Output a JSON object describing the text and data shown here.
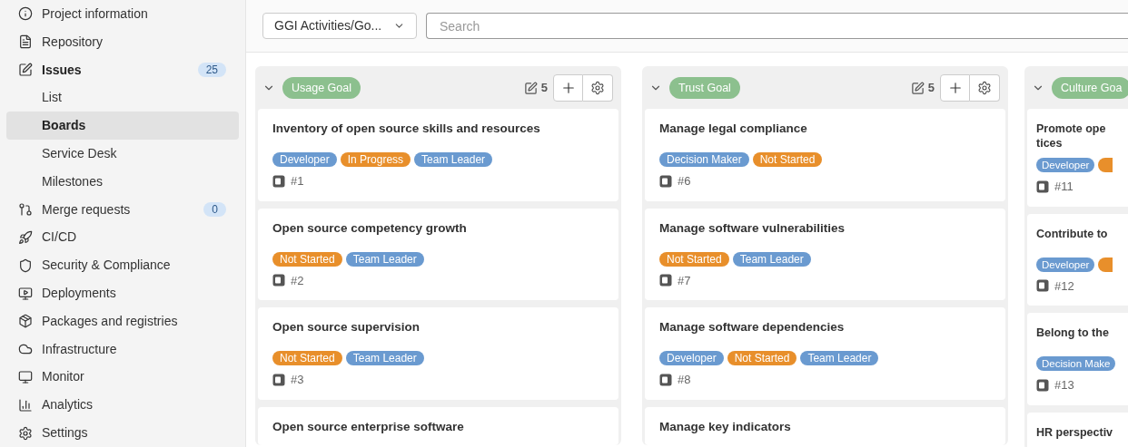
{
  "sidebar": {
    "items": [
      {
        "kind": "section",
        "label": "Project information",
        "selected": false,
        "expanded": false
      },
      {
        "kind": "section",
        "label": "Repository",
        "selected": false,
        "expanded": false
      },
      {
        "kind": "section",
        "label": "Issues",
        "selected": false,
        "expanded": true,
        "badge": "25"
      },
      {
        "kind": "sub",
        "label": "List",
        "selected": false
      },
      {
        "kind": "sub",
        "label": "Boards",
        "selected": true
      },
      {
        "kind": "sub",
        "label": "Service Desk",
        "selected": false
      },
      {
        "kind": "sub",
        "label": "Milestones",
        "selected": false
      },
      {
        "kind": "section",
        "label": "Merge requests",
        "selected": false,
        "expanded": false,
        "badge": "0"
      },
      {
        "kind": "section",
        "label": "CI/CD",
        "selected": false,
        "expanded": false
      },
      {
        "kind": "section",
        "label": "Security & Compliance",
        "selected": false,
        "expanded": false
      },
      {
        "kind": "section",
        "label": "Deployments",
        "selected": false,
        "expanded": false
      },
      {
        "kind": "section",
        "label": "Packages and registries",
        "selected": false,
        "expanded": false
      },
      {
        "kind": "section",
        "label": "Infrastructure",
        "selected": false,
        "expanded": false
      },
      {
        "kind": "section",
        "label": "Monitor",
        "selected": false,
        "expanded": false
      },
      {
        "kind": "section",
        "label": "Analytics",
        "selected": false,
        "expanded": false
      },
      {
        "kind": "section",
        "label": "Settings",
        "selected": false,
        "expanded": false
      }
    ]
  },
  "toolbar": {
    "board_select": "GGI Activities/Go...",
    "search": {
      "placeholder": "Search"
    }
  },
  "columns": [
    {
      "title": "Usage Goal",
      "count": "5",
      "cards": [
        {
          "title_lines": [
            "Inventory of open source skills and resources"
          ],
          "labels": [
            {
              "text": "Developer",
              "color": "#6a9ad0"
            },
            {
              "text": "In Progress",
              "color": "#e88f2b"
            },
            {
              "text": "Team Leader",
              "color": "#6a9ad0"
            }
          ],
          "number": "#1"
        },
        {
          "title_lines": [
            "Open source competency growth"
          ],
          "labels": [
            {
              "text": "Not Started",
              "color": "#e88f2b"
            },
            {
              "text": "Team Leader",
              "color": "#6a9ad0"
            }
          ],
          "number": "#2"
        },
        {
          "title_lines": [
            "Open source supervision"
          ],
          "labels": [
            {
              "text": "Not Started",
              "color": "#e88f2b"
            },
            {
              "text": "Team Leader",
              "color": "#6a9ad0"
            }
          ],
          "number": "#3"
        },
        {
          "title_lines": [
            "Open source enterprise software"
          ]
        }
      ]
    },
    {
      "title": "Trust Goal",
      "count": "5",
      "cards": [
        {
          "title_lines": [
            "Manage legal compliance"
          ],
          "labels": [
            {
              "text": "Decision Maker",
              "color": "#6a9ad0"
            },
            {
              "text": "Not Started",
              "color": "#e88f2b"
            }
          ],
          "number": "#6"
        },
        {
          "title_lines": [
            "Manage software vulnerabilities"
          ],
          "labels": [
            {
              "text": "Not Started",
              "color": "#e88f2b"
            },
            {
              "text": "Team Leader",
              "color": "#6a9ad0"
            }
          ],
          "number": "#7"
        },
        {
          "title_lines": [
            "Manage software dependencies"
          ],
          "labels": [
            {
              "text": "Developer",
              "color": "#6a9ad0"
            },
            {
              "text": "Not Started",
              "color": "#e88f2b"
            },
            {
              "text": "Team Leader",
              "color": "#6a9ad0"
            }
          ],
          "number": "#8"
        },
        {
          "title_lines": [
            "Manage key indicators"
          ]
        }
      ]
    },
    {
      "title": "Culture Goa",
      "cards": [
        {
          "title_lines": [
            "Promote ope",
            "tices"
          ],
          "labels": [
            {
              "text": "Developer",
              "color": "#6a9ad0"
            },
            {
              "color": "#e88f2b"
            }
          ],
          "number": "#11"
        },
        {
          "title_lines": [
            "Contribute to"
          ],
          "labels": [
            {
              "text": "Developer",
              "color": "#6a9ad0"
            },
            {
              "color": "#e88f2b"
            }
          ],
          "number": "#12"
        },
        {
          "title_lines": [
            "Belong to the"
          ],
          "labels": [
            {
              "text": "Decision Make",
              "color": "#6a9ad0"
            }
          ],
          "number": "#13"
        },
        {
          "title_lines": [
            "HR perspectiv"
          ]
        }
      ]
    }
  ]
}
